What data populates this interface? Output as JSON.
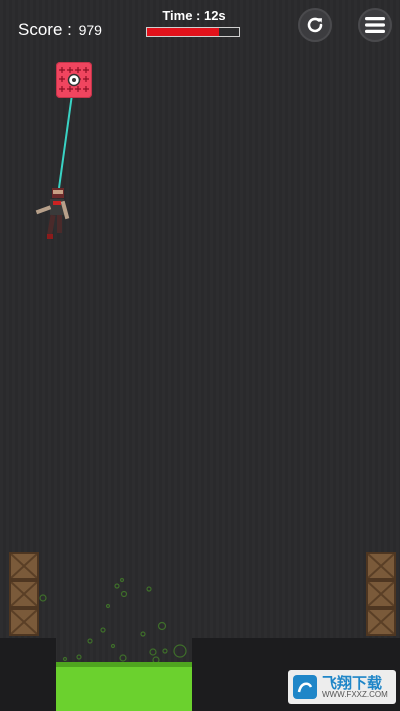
{
  "hud": {
    "score_label": "Score :",
    "score_value": "979",
    "time_label": "Time : 12s",
    "time_remaining_fraction": 0.78,
    "restart_icon": "restart-icon",
    "menu_icon": "hamburger-menu-icon"
  },
  "colors": {
    "background": "#2b2b2d",
    "timebar_fill": "#e2121b",
    "anchor_block": "#f0455f",
    "rope": "#39d3c4",
    "acid": "#6bd12e",
    "crate": "#7a5a3a"
  },
  "scene": {
    "anchor_icon": "target-anchor-icon",
    "player_icon": "ragdoll-character-icon",
    "hazard": "acid-pool",
    "crates": "wooden-crate-icon"
  },
  "watermark": {
    "title": "飞翔下载",
    "subtitle": "WWW.FXXZ.COM"
  }
}
